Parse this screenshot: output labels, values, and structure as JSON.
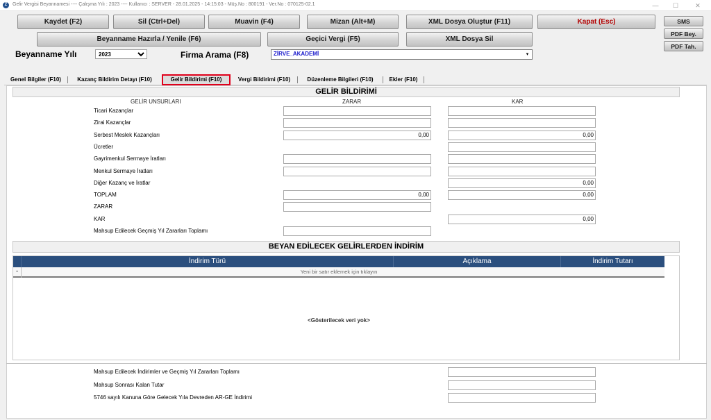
{
  "window": {
    "title": "Gelir Vergisi Beyannamesi  ----  Çalışma Yılı : 2023  ----  Kullanıcı : SERVER  -  28.01.2025 - 14:15:03  -  Müş.No : 800191  -  Ver.No : 070125-02.1",
    "app_icon": "Z",
    "minimize": "—",
    "maximize": "☐",
    "close": "✕"
  },
  "toolbar": {
    "kaydet": "Kaydet (F2)",
    "sil": "Sil (Ctrl+Del)",
    "muavin": "Muavin (F4)",
    "mizan": "Mizan (Alt+M)",
    "xml_olustur": "XML Dosya Oluştur (F11)",
    "kapat": "Kapat (Esc)",
    "beyanname_hazirla": "Beyanname Hazırla / Yenile (F6)",
    "gecici_vergi": "Geçici Vergi (F5)",
    "xml_sil": "XML Dosya Sil",
    "sms": "SMS",
    "pdf_bey": "PDF Bey.",
    "pdf_tah": "PDF Tah."
  },
  "filters": {
    "yil_label": "Beyanname Yılı",
    "yil_value": "2023",
    "firma_label": "Firma Arama (F8)",
    "firma_value": "ZİRVE_AKADEMİ",
    "dropdown_arrow": "▾"
  },
  "tabs": [
    "Genel Bilgiler (F10)",
    "Kazanç Bildirim Detayı (F10)",
    "Gelir Bildirimi (F10)",
    "Vergi Bildirimi (F10)",
    "Düzenleme Bilgileri (F10)",
    "Ekler (F10)"
  ],
  "gelir": {
    "section_title": "GELİR BİLDİRİMİ",
    "col_unsurlar": "GELİR UNSURLARI",
    "col_zarar": "ZARAR",
    "col_kar": "KAR",
    "rows": [
      {
        "label": "Ticari Kazançlar",
        "zarar": "",
        "kar": ""
      },
      {
        "label": "Zirai Kazançlar",
        "zarar": "",
        "kar": ""
      },
      {
        "label": "Serbest Meslek Kazançları",
        "zarar": "0,00",
        "kar": "0,00"
      },
      {
        "label": "Ücretler",
        "zarar": null,
        "kar": ""
      },
      {
        "label": "Gayrimenkul Sermaye İratları",
        "zarar": "",
        "kar": ""
      },
      {
        "label": "Menkul Sermaye İratları",
        "zarar": "",
        "kar": ""
      },
      {
        "label": "Diğer Kazanç ve İratlar",
        "zarar": null,
        "kar": "0,00"
      },
      {
        "label": "TOPLAM",
        "zarar": "0,00",
        "kar": "0,00"
      },
      {
        "label": "ZARAR",
        "zarar": "",
        "kar": null
      },
      {
        "label": "KAR",
        "zarar": null,
        "kar": "0,00"
      },
      {
        "label": "Mahsup Edilecek Geçmiş Yıl Zararları Toplamı",
        "zarar": "",
        "kar": null
      }
    ]
  },
  "indirim": {
    "section_title": "BEYAN EDİLECEK GELİRLERDEN İNDİRİM",
    "columns": [
      "İndirim Türü",
      "Açıklama",
      "İndirim Tutarı"
    ],
    "new_row_text": "Yeni bir satır eklemek için tıklayın",
    "row_indicator": "•",
    "empty_text": "<Gösterilecek veri yok>"
  },
  "summary": [
    {
      "label": "Mahsup Edilecek İndirimler ve Geçmiş Yıl Zararları Toplamı",
      "value": ""
    },
    {
      "label": "Mahsup Sonrası Kalan Tutar",
      "value": ""
    },
    {
      "label": "5746 sayılı Kanuna Göre Gelecek Yıla Devreden AR-GE İndirimi",
      "value": ""
    }
  ]
}
